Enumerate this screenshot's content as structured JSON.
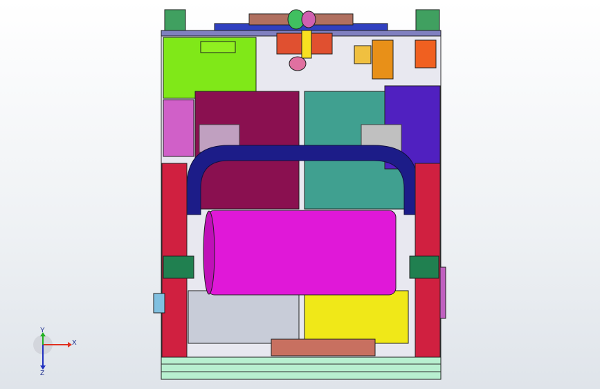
{
  "viewport": {
    "background": "#eef1f4",
    "triad": {
      "x_label": "X",
      "y_label": "Y",
      "z_label": "Z",
      "x_color": "#e03020",
      "y_color": "#20b020",
      "z_color": "#2030c0"
    }
  },
  "parts": [
    {
      "name": "frame-left-upright",
      "color": "#c8d0e0"
    },
    {
      "name": "green-block-left",
      "color": "#80e818"
    },
    {
      "name": "magenta-panel-left",
      "color": "#d060c8"
    },
    {
      "name": "maroon-motor-left",
      "color": "#8a1050"
    },
    {
      "name": "teal-motor-right",
      "color": "#40a090"
    },
    {
      "name": "blue-frame-right",
      "color": "#5020c0"
    },
    {
      "name": "navy-belt-guard",
      "color": "#1c1c88"
    },
    {
      "name": "magenta-cylinder-drum",
      "color": "#e018d8"
    },
    {
      "name": "silver-hopper-left",
      "color": "#c8ccd8"
    },
    {
      "name": "yellow-hopper-right",
      "color": "#f0e818"
    },
    {
      "name": "copper-roller-bottom",
      "color": "#c87060"
    },
    {
      "name": "base-plate",
      "color": "#b8f0d0"
    },
    {
      "name": "orange-coupling",
      "color": "#e89018"
    }
  ]
}
